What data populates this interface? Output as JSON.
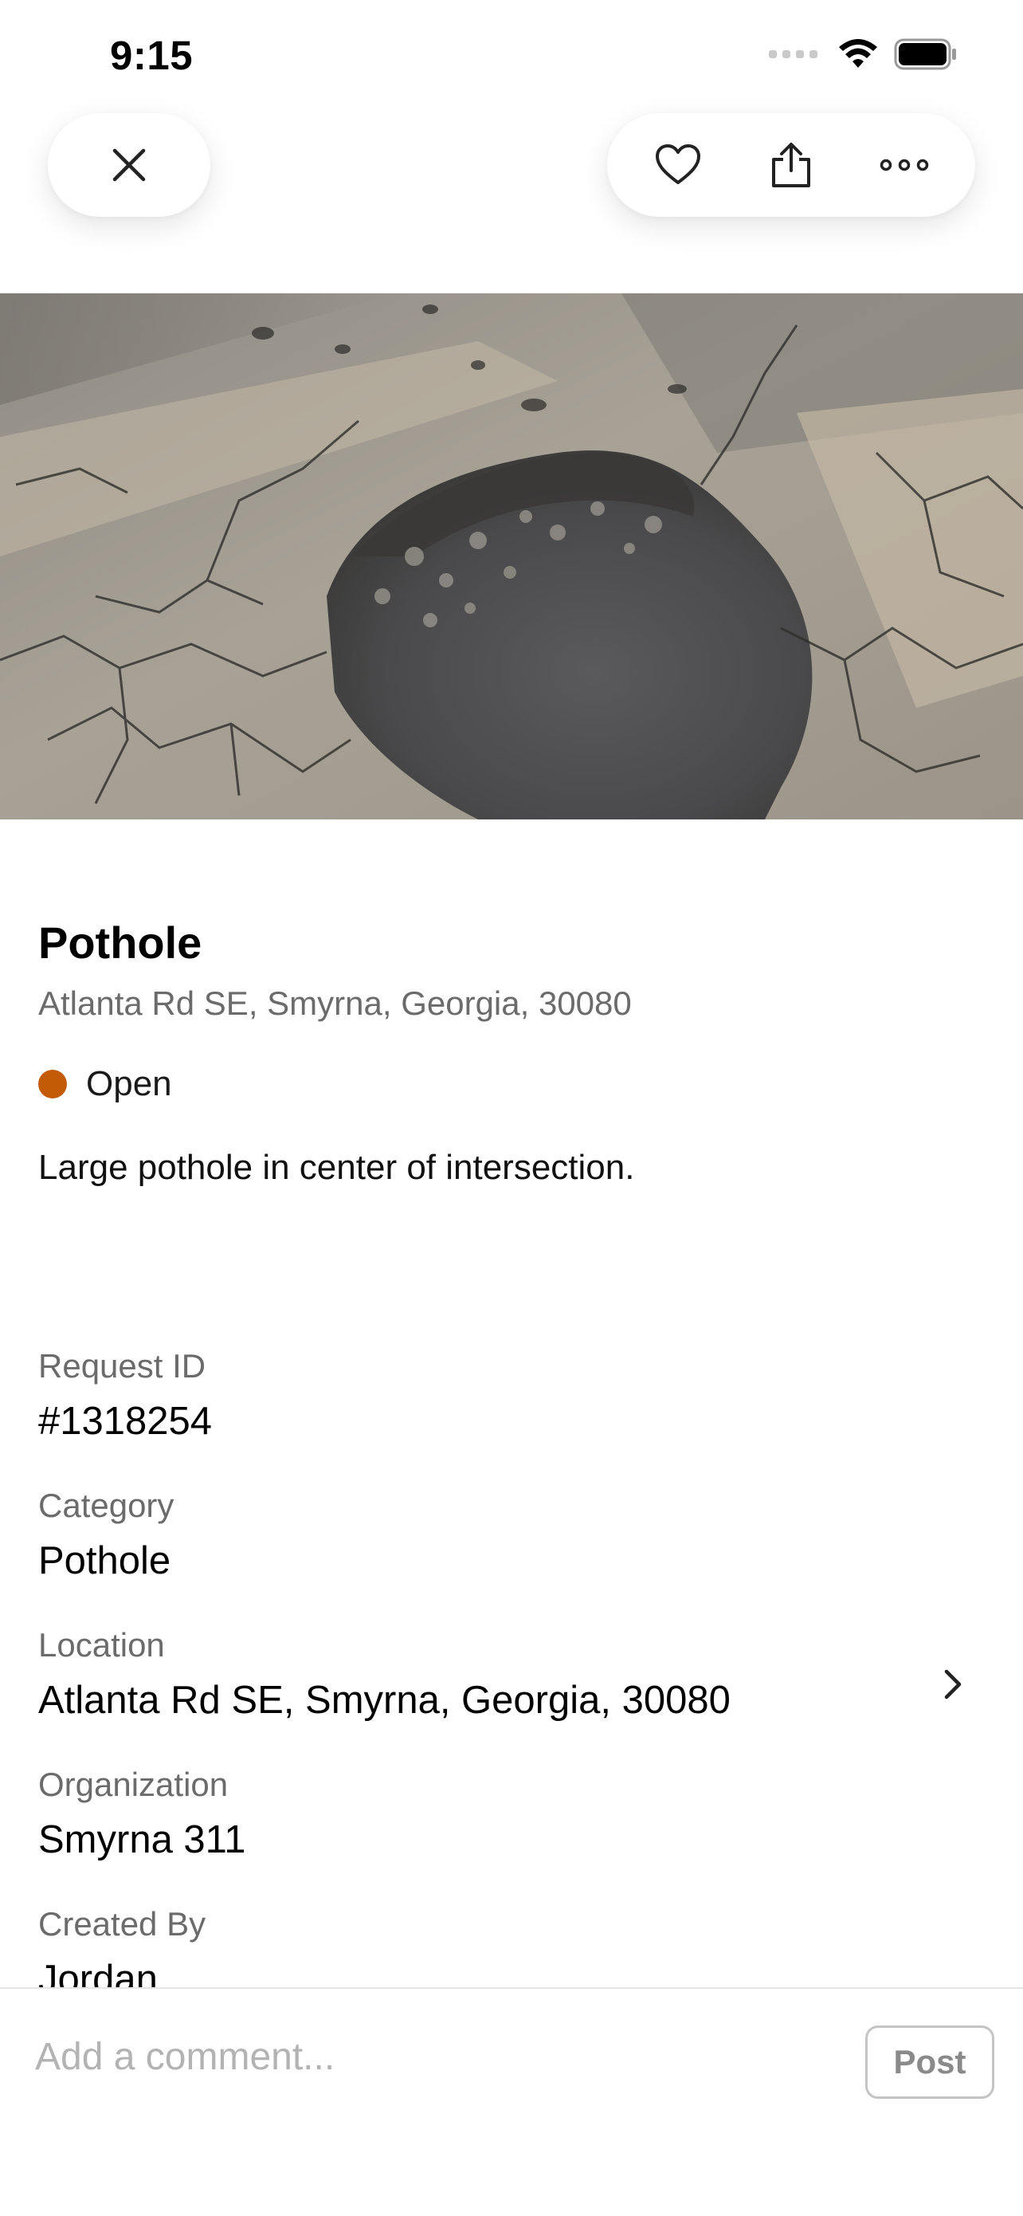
{
  "status_bar": {
    "time": "9:15",
    "icons": [
      "cellular-signal-icon",
      "wifi-icon",
      "battery-icon"
    ]
  },
  "toolbar": {
    "close_icon": "close-icon",
    "favorite_icon": "heart-icon",
    "share_icon": "share-icon",
    "more_icon": "more-icon"
  },
  "photo": {
    "subject": "pothole-photo"
  },
  "request": {
    "title": "Pothole",
    "address": "Atlanta Rd SE, Smyrna, Georgia, 30080",
    "status": "Open",
    "status_color": "#c35a06",
    "description": "Large pothole in center of intersection."
  },
  "details": [
    {
      "label": "Request ID",
      "value": "#1318254"
    },
    {
      "label": "Category",
      "value": "Pothole"
    },
    {
      "label": "Location",
      "value": "Atlanta Rd SE, Smyrna, Georgia, 30080"
    },
    {
      "label": "Organization",
      "value": "Smyrna 311"
    },
    {
      "label": "Created By",
      "value": "Jordan"
    }
  ],
  "comment": {
    "placeholder": "Add a comment...",
    "post_label": "Post"
  }
}
